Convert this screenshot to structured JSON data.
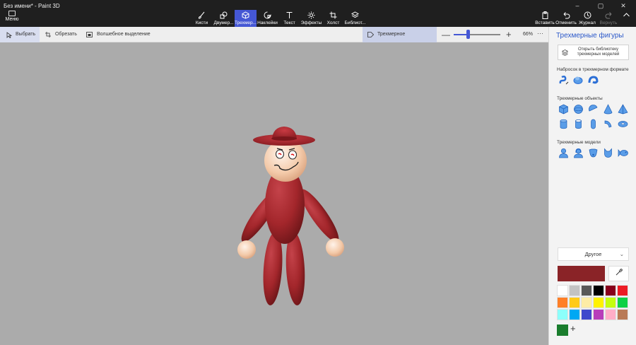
{
  "window": {
    "title": "Без имени* - Paint 3D",
    "menu_label": "Меню",
    "controls": [
      "–",
      "▢",
      "✕"
    ]
  },
  "main_tools": [
    {
      "label": "Кисти",
      "icon": "brush-icon",
      "active": false
    },
    {
      "label": "Двумер...",
      "icon": "2d-shapes-icon",
      "active": false
    },
    {
      "label": "Трехмер...",
      "icon": "3d-shapes-icon",
      "active": true
    },
    {
      "label": "Наклейки",
      "icon": "stickers-icon",
      "active": false
    },
    {
      "label": "Текст",
      "icon": "text-icon",
      "active": false
    },
    {
      "label": "Эффекты",
      "icon": "effects-icon",
      "active": false
    },
    {
      "label": "Холст",
      "icon": "canvas-icon",
      "active": false
    },
    {
      "label": "Библиот...",
      "icon": "library-icon",
      "active": false
    }
  ],
  "right_tools": [
    {
      "label": "Вставить",
      "icon": "paste-icon",
      "disabled": false
    },
    {
      "label": "Отменить",
      "icon": "undo-icon",
      "disabled": false
    },
    {
      "label": "Журнал",
      "icon": "history-icon",
      "disabled": false
    },
    {
      "label": "Вернуть",
      "icon": "redo-icon",
      "disabled": true
    }
  ],
  "toolbar": {
    "select": "Выбрать",
    "crop": "Обрезать",
    "magic_select": "Волшебное выделение",
    "view_3d": "Трехмерное представление",
    "zoom_minus": "—",
    "zoom_plus": "+",
    "zoom_value": "66%",
    "zoom_fraction": 0.3,
    "more": "···"
  },
  "panel": {
    "title": "Трехмерные фигуры",
    "library_button": "Открыть библиотеку трехмерных моделей",
    "sketch_section": "Набросок в трехмерном формате",
    "objects_section": "Трехмерные объекты",
    "models_section": "Трехмерные модели",
    "sketch_icons": [
      "sharp-edge-sketch-icon",
      "soft-edge-sketch-icon",
      "tube-sketch-icon"
    ],
    "object_icons": [
      "cube-icon",
      "sphere-icon",
      "hemisphere-icon",
      "cone-icon",
      "pyramid-icon",
      "cylinder-icon",
      "tube-icon",
      "capsule-icon",
      "torus-segment-icon",
      "donut-icon"
    ],
    "model_icons": [
      "man-icon",
      "woman-icon",
      "dog-icon",
      "cat-icon",
      "fish-icon"
    ],
    "dropdown_label": "Другое",
    "current_color": "#8a2327",
    "palette": [
      "#ffffff",
      "#c3c3c3",
      "#585858",
      "#000000",
      "#88001b",
      "#ec1c24",
      "#ff7f27",
      "#ffca18",
      "#fdeca6",
      "#fff200",
      "#c4ff0e",
      "#0ed145",
      "#8cfffb",
      "#00a8f3",
      "#3f48cc",
      "#b83dba",
      "#ffaec8",
      "#b97a56"
    ],
    "custom_color": "#1a7d2d",
    "add_color_label": "+"
  },
  "colors": {
    "accent": "#4557d4",
    "figure_red": "#a3262b",
    "skin": "#f3c9a8",
    "canvas_bg": "#ababab"
  }
}
